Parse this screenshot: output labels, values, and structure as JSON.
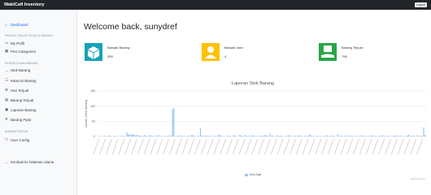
{
  "app": {
    "title": "WaktCafI Inventory",
    "logout_label": "Logout"
  },
  "sidebar": {
    "dashboard": "Dashboard",
    "section1": "PRODUK (SALDO STOK) & BARANG",
    "items1": [
      "My Profil",
      "Pesi Categories"
    ],
    "section2": "PENGELOLAAN BARANG",
    "items2": [
      "Stok Barang",
      "Katecori Barang",
      "Hari Terjual",
      "Barang Terjual",
      "Laporan Barang",
      "Barang Pylar"
    ],
    "section3": "ADMINISTRATOR",
    "items3": [
      "User Config"
    ],
    "footer": "Kembali ke halaman utama"
  },
  "main": {
    "welcome": "Welcome back, sunydref",
    "cards": [
      {
        "label": "Banyak Barang :",
        "value": "355",
        "icon": "box-icon",
        "color": "#17a2b8"
      },
      {
        "label": "Banyak User :",
        "value": "4",
        "icon": "user-icon",
        "color": "#ffc107"
      },
      {
        "label": "Barang Terjual :",
        "value": "795",
        "icon": "hand-box-icon",
        "color": "#28a745"
      }
    ]
  },
  "chart_data": {
    "type": "bar",
    "title": "Laporan Stok Barang",
    "ylabel": "Jumlah (Stok) Barang",
    "ylim": [
      0,
      150
    ],
    "yticks": [
      0,
      50,
      100,
      150
    ],
    "legend": [
      "Stok Saat"
    ],
    "series": [
      {
        "name": "Stok Saat",
        "color": "#9ec5f3",
        "values": [
          2,
          1,
          0,
          1,
          3,
          1,
          0,
          2,
          4,
          1,
          1,
          0,
          3,
          2,
          1,
          1,
          0,
          2,
          1,
          3,
          1,
          0,
          14,
          8,
          6,
          4,
          9,
          5,
          7,
          3,
          5,
          4,
          2,
          3,
          1,
          2,
          5,
          3,
          1,
          2,
          4,
          3,
          2,
          1,
          0,
          3,
          2,
          5,
          1,
          2,
          1,
          0,
          2,
          1,
          3,
          2,
          4,
          1,
          91,
          93,
          1,
          0,
          2,
          4,
          1,
          3,
          1,
          2,
          0,
          1,
          2,
          3,
          1,
          5,
          4,
          2,
          1,
          0,
          3,
          1,
          28,
          2,
          3,
          1,
          4,
          2,
          1,
          3,
          0,
          2,
          1,
          3,
          1,
          2,
          4,
          6,
          3,
          2,
          1,
          0,
          2,
          1,
          3,
          2,
          1,
          0,
          4,
          3,
          2,
          1,
          0,
          6,
          3,
          2,
          1,
          5,
          2,
          1,
          3,
          1,
          2,
          4,
          3,
          1,
          2,
          1,
          0,
          3,
          2,
          1,
          4,
          5,
          3,
          2,
          1,
          9,
          2,
          3,
          1,
          0,
          2,
          4,
          1,
          3,
          2,
          1,
          0,
          2,
          1,
          3,
          4,
          2,
          1,
          0,
          3,
          2,
          1,
          4,
          2,
          3,
          1,
          0,
          2,
          1,
          3,
          2,
          7,
          4,
          1,
          2,
          1,
          0,
          3,
          2,
          1,
          2,
          1,
          0,
          2,
          4,
          3,
          1,
          2,
          1,
          3,
          2,
          1,
          0,
          8,
          1,
          2,
          3,
          1,
          0,
          2,
          1,
          4,
          2,
          1,
          3,
          2,
          1,
          0,
          3,
          1,
          2,
          4,
          1,
          3,
          2,
          1,
          2,
          0,
          1,
          4,
          2,
          3,
          1,
          2,
          1,
          0,
          3,
          2,
          1,
          4,
          2,
          1,
          3,
          2,
          1,
          0,
          2,
          1,
          3,
          2,
          4,
          1,
          2,
          3,
          1,
          0,
          2,
          1,
          3,
          6,
          2,
          1,
          3,
          2,
          1,
          0,
          4,
          2,
          1,
          3,
          2,
          30,
          5,
          1
        ]
      }
    ]
  },
  "footer_note": "Highcharts.com"
}
